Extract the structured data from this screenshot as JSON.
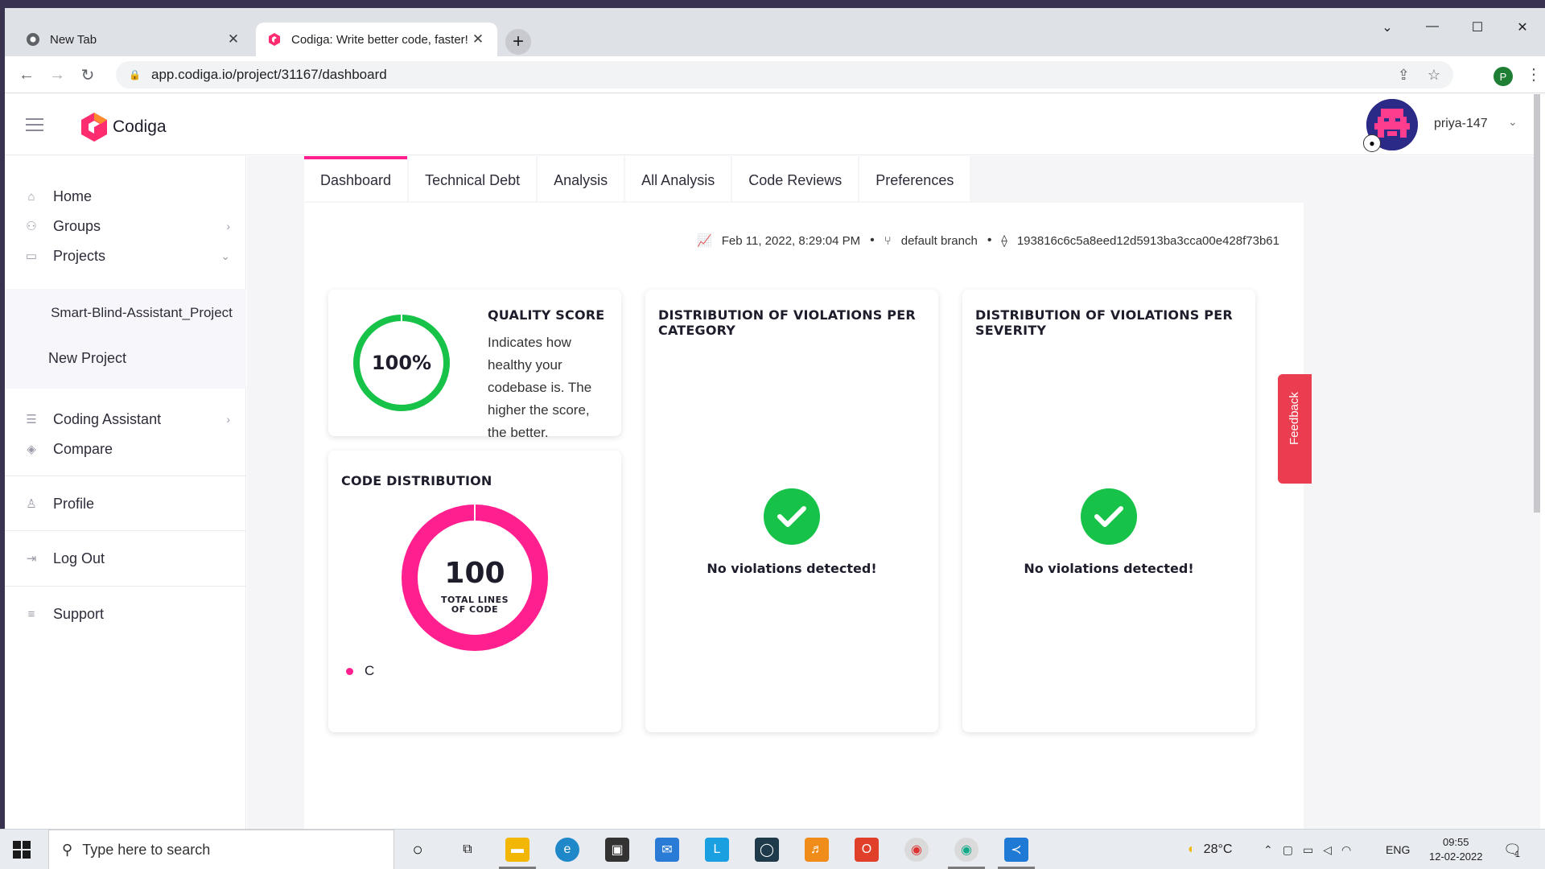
{
  "browser": {
    "tabs": [
      {
        "title": "New Tab",
        "active": false
      },
      {
        "title": "Codiga: Write better code, faster!",
        "active": true
      }
    ],
    "url": "app.codiga.io/project/31167/dashboard",
    "profile_initial": "P"
  },
  "app": {
    "logo_text": "Codiga",
    "username": "priya-147"
  },
  "sidebar": {
    "items": [
      {
        "label": "Home",
        "icon": "home-icon"
      },
      {
        "label": "Groups",
        "icon": "groups-icon"
      },
      {
        "label": "Projects",
        "icon": "projects-icon"
      }
    ],
    "project_name": "Smart-Blind-Assistant_Project",
    "new_project": "New Project",
    "items2": [
      {
        "label": "Coding Assistant",
        "icon": "list-icon"
      },
      {
        "label": "Compare",
        "icon": "layers-icon"
      }
    ],
    "profile": "Profile",
    "logout": "Log Out",
    "support": "Support"
  },
  "tabs": [
    "Dashboard",
    "Technical Debt",
    "Analysis",
    "All Analysis",
    "Code Reviews",
    "Preferences"
  ],
  "meta": {
    "date": "Feb 11, 2022, 8:29:04 PM",
    "branch": "default branch",
    "commit": "193816c6c5a8eed12d5913ba3cca00e428f73b61"
  },
  "quality_score": {
    "title": "QUALITY SCORE",
    "value": "100%",
    "percent": 100,
    "description": "Indicates how healthy your codebase is. The higher the score, the better.",
    "color": "#16c247"
  },
  "code_distribution": {
    "title": "CODE DISTRIBUTION",
    "total": "100",
    "total_label": "TOTAL LINES OF CODE",
    "legend": [
      {
        "label": "C",
        "color": "#ff1f8e"
      }
    ]
  },
  "category_card": {
    "title": "DISTRIBUTION OF VIOLATIONS PER CATEGORY",
    "message": "No violations detected!"
  },
  "severity_card": {
    "title": "DISTRIBUTION OF VIOLATIONS PER SEVERITY",
    "message": "No violations detected!"
  },
  "feedback_label": "Feedback",
  "taskbar": {
    "search_placeholder": "Type here to search",
    "temperature": "28°C",
    "language": "ENG",
    "time": "09:55",
    "date": "12-02-2022",
    "notification_count": "1"
  }
}
